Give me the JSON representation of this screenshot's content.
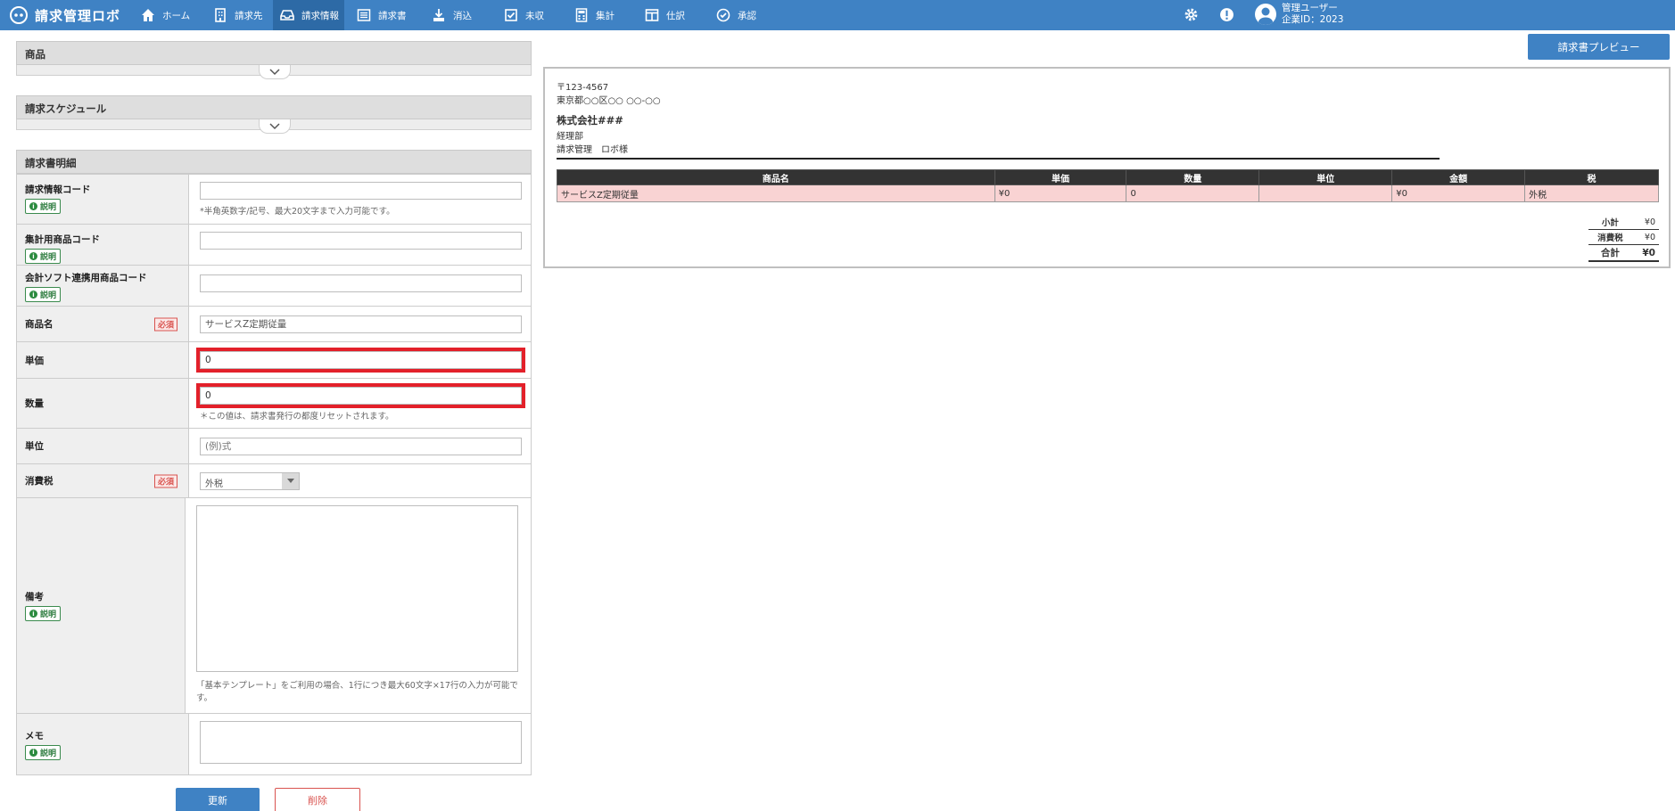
{
  "app": {
    "title": "請求管理ロボ"
  },
  "nav": [
    {
      "label": "ホーム",
      "icon": "home-icon"
    },
    {
      "label": "請求先",
      "icon": "building-icon"
    },
    {
      "label": "請求情報",
      "icon": "inbox-icon",
      "active": true
    },
    {
      "label": "請求書",
      "icon": "list-icon"
    },
    {
      "label": "消込",
      "icon": "download-icon"
    },
    {
      "label": "未収",
      "icon": "checkbox-icon"
    },
    {
      "label": "集計",
      "icon": "calculator-icon"
    },
    {
      "label": "仕訳",
      "icon": "columns-icon"
    },
    {
      "label": "承認",
      "icon": "check-circle-icon"
    }
  ],
  "user": {
    "name": "管理ユーザー",
    "company": "企業ID：2023"
  },
  "sections": {
    "product": "商品",
    "schedule": "請求スケジュール",
    "detail": "請求書明細"
  },
  "common": {
    "help_label": "説明",
    "required_label": "必須"
  },
  "fields": {
    "code": {
      "label": "請求情報コード",
      "value": "",
      "hint": "*半角英数字/記号、最大20文字まで入力可能です。"
    },
    "agg_code": {
      "label": "集計用商品コード",
      "value": ""
    },
    "acct_code": {
      "label": "会計ソフト連携用商品コード",
      "value": ""
    },
    "name": {
      "label": "商品名",
      "value": "サービスZ定期従量"
    },
    "unit_price": {
      "label": "単価",
      "value": "0"
    },
    "quantity": {
      "label": "数量",
      "value": "0",
      "hint": "＊この値は、請求書発行の都度リセットされます。"
    },
    "unit": {
      "label": "単位",
      "placeholder": "(例)式"
    },
    "tax": {
      "label": "消費税",
      "value": "外税"
    },
    "remarks": {
      "label": "備考",
      "hint": "「基本テンプレート」をご利用の場合、1行につき最大60文字×17行の入力が可能です。"
    },
    "memo": {
      "label": "メモ"
    }
  },
  "buttons": {
    "update": "更新",
    "delete": "削除",
    "preview": "請求書プレビュー"
  },
  "preview": {
    "postal": "〒123-4567",
    "address": "東京都○○区○○ ○○-○○",
    "company": "株式会社###",
    "department": "経理部",
    "recipient": "請求管理　ロボ様",
    "table": {
      "headers": [
        "商品名",
        "単価",
        "数量",
        "単位",
        "金額",
        "税"
      ],
      "row": [
        "サービスZ定期従量",
        "¥0",
        "0",
        "",
        "¥0",
        "外税"
      ]
    },
    "totals": [
      {
        "label": "小計",
        "value": "¥0"
      },
      {
        "label": "消費税",
        "value": "¥0"
      },
      {
        "label": "合計",
        "value": "¥0"
      }
    ]
  }
}
